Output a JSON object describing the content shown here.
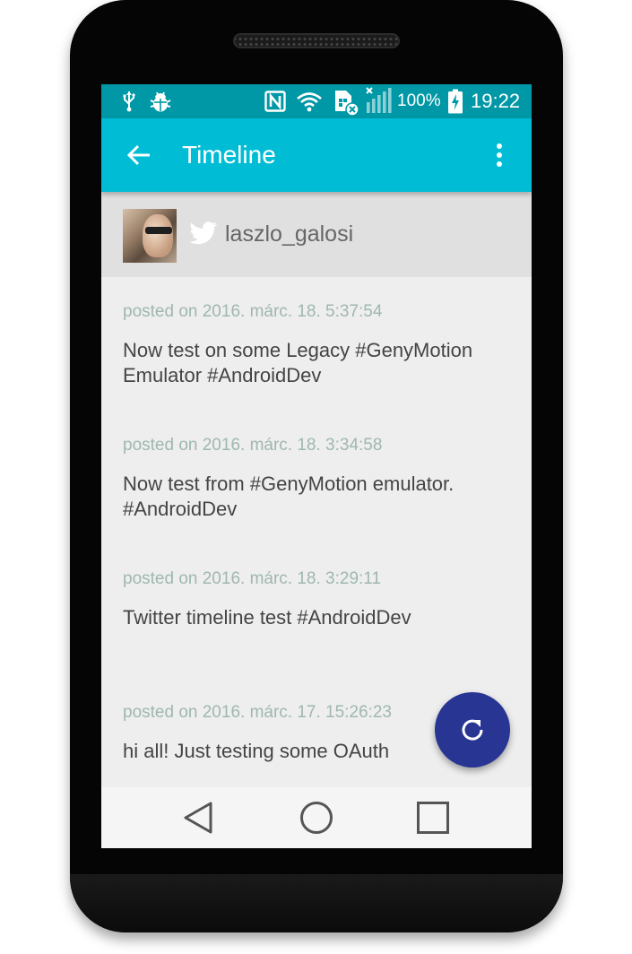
{
  "status_bar": {
    "icons": [
      "usb-icon",
      "bug-icon",
      "nfc-icon",
      "wifi-icon",
      "no-sim-icon",
      "signal-icon",
      "battery-charging-icon"
    ],
    "battery_percent": "100%",
    "time": "19:22"
  },
  "app_bar": {
    "title": "Timeline",
    "back_icon": "arrow-back-icon",
    "menu_icon": "more-vert-icon"
  },
  "profile": {
    "username": "laszlo_galosi",
    "service_icon": "twitter-icon"
  },
  "posts": [
    {
      "date": "posted on 2016. márc. 18. 5:37:54",
      "text": "Now test on some Legacy #GenyMotion Emulator #AndroidDev"
    },
    {
      "date": "posted on 2016. márc. 18. 3:34:58",
      "text": "Now test from #GenyMotion emulator. #AndroidDev"
    },
    {
      "date": "posted on 2016. márc. 18. 3:29:11",
      "text": "Twitter timeline test #AndroidDev"
    },
    {
      "date": "posted on 2016. márc. 17. 15:26:23",
      "text": "hi all! Just testing some OAuth"
    }
  ],
  "fab": {
    "icon": "refresh-icon"
  },
  "nav_bar": {
    "icons": [
      "nav-back-icon",
      "nav-home-icon",
      "nav-recents-icon"
    ]
  },
  "colors": {
    "status_bar": "#0098a6",
    "app_bar": "#00bcd4",
    "fab": "#283593",
    "profile_bg": "#e0e0e0",
    "content_bg": "#eeeeee",
    "date_text": "#9fb7ae",
    "body_text": "#444444"
  }
}
